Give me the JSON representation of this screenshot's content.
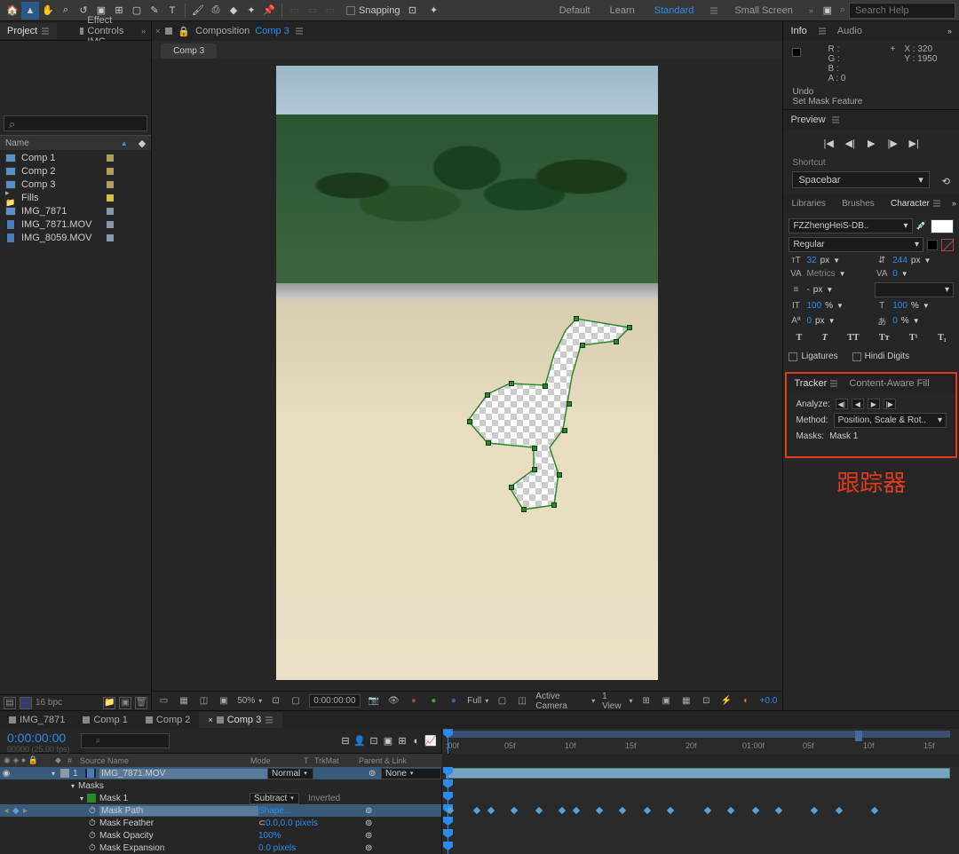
{
  "toolbar": {
    "snapping_label": "Snapping",
    "workspaces": [
      "Default",
      "Learn",
      "Standard",
      "Small Screen"
    ],
    "active_workspace": 2,
    "search_placeholder": "Search Help"
  },
  "project": {
    "tab_label": "Project",
    "effect_controls_tab": "Effect Controls IMG_",
    "name_header": "Name",
    "items": [
      {
        "icon": "comp",
        "name": "Comp 1",
        "color": "#b0a060"
      },
      {
        "icon": "comp",
        "name": "Comp 2",
        "color": "#b0a060"
      },
      {
        "icon": "comp",
        "name": "Comp 3",
        "color": "#b0a060"
      },
      {
        "icon": "folder",
        "name": "Fills",
        "color": "#d4c040"
      },
      {
        "icon": "comp",
        "name": "IMG_7871",
        "color": "#8899aa"
      },
      {
        "icon": "mov",
        "name": "IMG_7871.MOV",
        "color": "#8899aa"
      },
      {
        "icon": "mov",
        "name": "IMG_8059.MOV",
        "color": "#8899aa"
      }
    ],
    "footer_bpc": "16 bpc"
  },
  "composition": {
    "tab_prefix": "Composition",
    "tab_name": "Comp 3",
    "sub_tab": "Comp 3"
  },
  "viewer_footer": {
    "zoom": "50%",
    "timecode": "0:00:00:00",
    "resolution": "Full",
    "camera": "Active Camera",
    "view": "1 View",
    "exposure": "+0.0"
  },
  "info": {
    "tabs": [
      "Info",
      "Audio"
    ],
    "r": "R :",
    "g": "G :",
    "b": "B :",
    "a_label": "A :",
    "a_val": "0",
    "x_label": "X :",
    "x_val": "320",
    "y_label": "Y :",
    "y_val": "1950",
    "undo_line1": "Undo",
    "undo_line2": "Set Mask Feature"
  },
  "preview": {
    "title": "Preview",
    "shortcut_label": "Shortcut",
    "shortcut_value": "Spacebar"
  },
  "character": {
    "tabs": [
      "Libraries",
      "Brushes",
      "Character"
    ],
    "font": "FZZhengHeiS-DB..",
    "style": "Regular",
    "font_size": "32",
    "leading": "244",
    "kerning": "Metrics",
    "tracking": "0",
    "stroke_dash": "-",
    "vscale": "100",
    "hscale": "100",
    "baseline": "0",
    "tsume": "0",
    "px": "px",
    "pct": "%",
    "ligatures": "Ligatures",
    "hindi": "Hindi Digits"
  },
  "tracker": {
    "tabs": [
      "Tracker",
      "Content-Aware Fill"
    ],
    "analyze_label": "Analyze:",
    "method_label": "Method:",
    "method_value": "Position, Scale & Rot..",
    "masks_label": "Masks:",
    "masks_value": "Mask 1",
    "annotation": "跟踪器"
  },
  "timeline": {
    "tabs": [
      "IMG_7871",
      "Comp 1",
      "Comp 2",
      "Comp 3"
    ],
    "active_tab": 3,
    "timecode": "0:00:00:00",
    "fps": "00000 (25.00 fps)",
    "headers": {
      "source": "Source Name",
      "mode": "Mode",
      "t": "T",
      "trkmat": "TrkMat",
      "parent": "Parent & Link"
    },
    "ticks": [
      ":00f",
      "05f",
      "10f",
      "15f",
      "20f",
      "01:00f",
      "05f",
      "10f",
      "15f"
    ],
    "layer": {
      "num": "1",
      "name": "IMG_7871.MOV",
      "mode": "Normal",
      "parent": "None"
    },
    "masks_label": "Masks",
    "mask_name": "Mask 1",
    "mask_mode": "Subtract",
    "inverted": "Inverted",
    "props": [
      {
        "name": "Mask Path",
        "value": "Shape..."
      },
      {
        "name": "Mask Feather",
        "value": "0.0,0.0 pixels"
      },
      {
        "name": "Mask Opacity",
        "value": "100%"
      },
      {
        "name": "Mask Expansion",
        "value": "0.0 pixels"
      }
    ]
  }
}
